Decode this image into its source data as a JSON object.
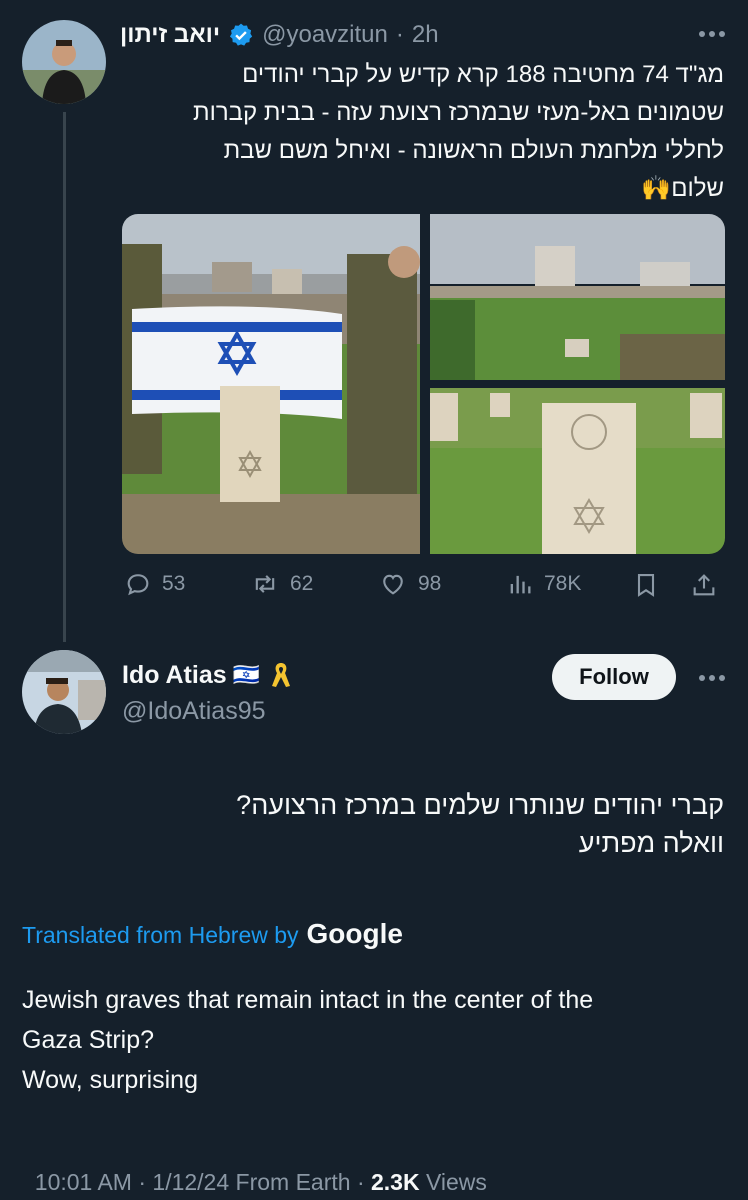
{
  "colors": {
    "background": "#15202b",
    "text": "#f7f9f9",
    "muted": "#8b98a5",
    "link": "#1d9bf0",
    "verified": "#1d9bf0",
    "ribbon": "#f4c430"
  },
  "parent_tweet": {
    "display_name": "יואב זיתון",
    "handle": "@yoavzitun",
    "time": "2h",
    "text_line1": "מג\"ד 74 מחטיבה 188 קרא קדיש על קברי יהודים",
    "text_line2": "שטמונים באל-מעזי שבמרכז רצועת עזה - בבית קברות",
    "text_line3": "לחללי מלחמת העולם הראשונה - ואיחל משם שבת",
    "text_line4": "שלום🙌",
    "photo_left_alt": "Soldiers holding Israeli flag behind a Star of David gravestone",
    "photo_top_right_alt": "War cemetery with rows of gravestones",
    "photo_bottom_right_alt": "Gravestone with Star of David",
    "stats": {
      "replies": "53",
      "reposts": "62",
      "likes": "98",
      "views": "78K"
    },
    "icons": [
      "reply-icon",
      "repost-icon",
      "like-icon",
      "views-icon",
      "bookmark-icon",
      "share-icon"
    ]
  },
  "reply_tweet": {
    "display_name": "Ido Atias",
    "flag": "🇮🇱",
    "ribbon": "🎗️",
    "handle": "@IdoAtias95",
    "follow_label": "Follow",
    "text_line1": "קברי יהודים שנותרו שלמים במרכז הרצועה?",
    "text_line2": "וואלה מפתיע",
    "translated_label": "Translated from Hebrew by",
    "translated_brand": "Google",
    "translation_line1": "Jewish graves that remain intact in the center of the",
    "translation_line2": "Gaza Strip?",
    "translation_line3": "Wow, surprising",
    "meta_time": "10:01 AM · 1/12/24 From Earth · ",
    "meta_views_count": "2.3K",
    "meta_views_label": " Views"
  },
  "separator": "·"
}
